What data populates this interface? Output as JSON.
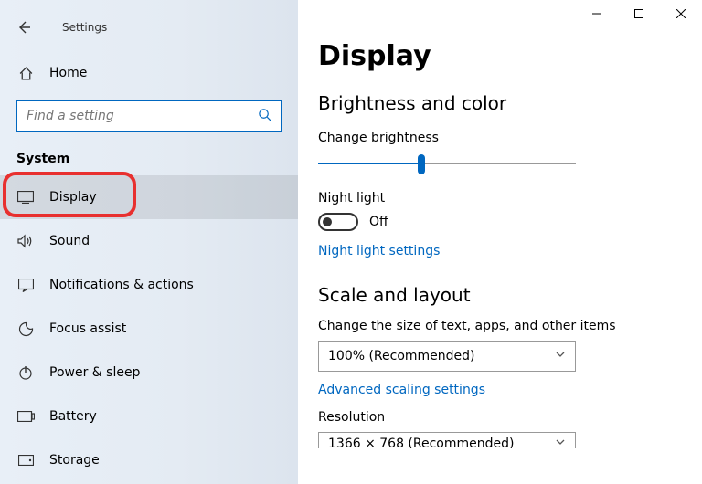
{
  "window": {
    "title": "Settings"
  },
  "sidebar": {
    "home_label": "Home",
    "search_placeholder": "Find a setting",
    "category": "System",
    "items": [
      {
        "label": "Display"
      },
      {
        "label": "Sound"
      },
      {
        "label": "Notifications & actions"
      },
      {
        "label": "Focus assist"
      },
      {
        "label": "Power & sleep"
      },
      {
        "label": "Battery"
      },
      {
        "label": "Storage"
      }
    ]
  },
  "main": {
    "title": "Display",
    "section_brightness": "Brightness and color",
    "brightness_label": "Change brightness",
    "nightlight_label": "Night light",
    "nightlight_state": "Off",
    "nightlight_link": "Night light settings",
    "section_scale": "Scale and layout",
    "scale_label": "Change the size of text, apps, and other items",
    "scale_value": "100% (Recommended)",
    "scaling_link": "Advanced scaling settings",
    "resolution_label": "Resolution",
    "resolution_value": "1366 × 768 (Recommended)"
  }
}
